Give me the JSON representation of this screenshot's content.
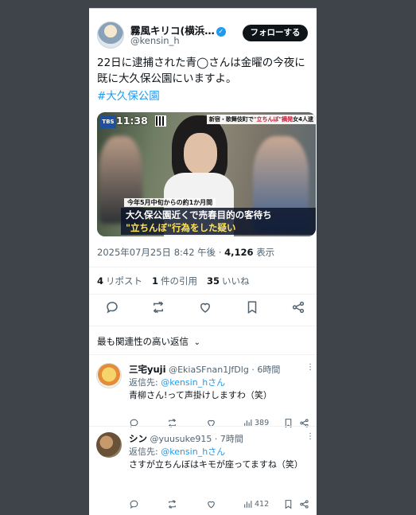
{
  "tweet": {
    "author_name": "霧風キリコ(横浜…",
    "author_handle": "@kensin_h",
    "follow_label": "フォローする",
    "more": "⋮",
    "text_line1": "22日に逮捕された青◯さんは金曜の今夜に",
    "text_line2": "既に大久保公園にいますよ。",
    "hashtag": "#大久保公園",
    "media": {
      "tbs": "TBS",
      "clock": "11:38",
      "headline_prefix": "新宿・歌舞伎町で",
      "headline_highlight": "\"立ちんぼ\"摘発",
      "headline_suffix": "女4人逮",
      "caption_small": "今年5月中旬からの約1か月間",
      "caption_line1": "大久保公園近くで売春目的の客待ち",
      "caption_line2": "\"立ちんぼ\"行為をした疑い"
    },
    "date": "2025年07月25日 8:42 午後",
    "views_count": "4,126",
    "views_label": "表示",
    "reposts_count": "4",
    "reposts_label": "リポスト",
    "quotes_count": "1",
    "quotes_label": "件の引用",
    "likes_count": "35",
    "likes_label": "いいね"
  },
  "replies_header": "最も関連性の高い返信",
  "replies": [
    {
      "name": "三宅yuji",
      "handle": "@EkiaSFnan1JfDlg",
      "time": "· 6時間",
      "reply_to_label": "返信先:",
      "reply_to": "@kensin_hさん",
      "text": "青柳さん!って声掛けしますわ（笑）",
      "views": "389"
    },
    {
      "name": "シン",
      "handle": "@yuusuke915",
      "time": "· 7時間",
      "reply_to_label": "返信先:",
      "reply_to": "@kensin_hさん",
      "text": "さすが立ちんぼはキモが座ってますね（笑）",
      "views": "412"
    }
  ]
}
